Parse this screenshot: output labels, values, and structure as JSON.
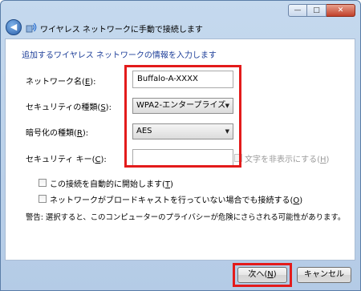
{
  "window": {
    "title": "ワイヤレス ネットワークに手動で接続します",
    "controls": {
      "minimize": "—",
      "maximize": "□",
      "close": "✕"
    }
  },
  "heading": "追加するワイヤレス ネットワークの情報を入力します",
  "form": {
    "network_name": {
      "label_pre": "ネットワーク名(",
      "key": "E",
      "label_post": "):",
      "value": "Buffalo-A-XXXX"
    },
    "security_type": {
      "label_pre": "セキュリティの種類(",
      "key": "S",
      "label_post": "):",
      "value": "WPA2-エンタープライズ"
    },
    "encryption_type": {
      "label_pre": "暗号化の種類(",
      "key": "R",
      "label_post": "):",
      "value": "AES"
    },
    "security_key": {
      "label_pre": "セキュリティ キー(",
      "key": "C",
      "label_post": "):",
      "value": ""
    },
    "hide_chars": {
      "label_pre": "文字を非表示にする(",
      "key": "H",
      "label_post": ")",
      "checked": false
    }
  },
  "options": {
    "auto_start": {
      "label_pre": "この接続を自動的に開始します(",
      "key": "T",
      "label_post": ")",
      "checked": false
    },
    "connect_hidden": {
      "label_pre": "ネットワークがブロードキャストを行っていない場合でも接続する(",
      "key": "O",
      "label_post": ")",
      "checked": false
    }
  },
  "warning": "警告: 選択すると、このコンピューターのプライバシーが危険にさらされる可能性があります。",
  "buttons": {
    "next": {
      "label_pre": "次へ(",
      "key": "N",
      "label_post": ")"
    },
    "cancel": "キャンセル"
  },
  "colors": {
    "highlight": "#e31b1b",
    "heading": "#1e3f99"
  },
  "icons": {
    "back": "back-arrow-icon",
    "wireless": "wireless-network-icon"
  }
}
